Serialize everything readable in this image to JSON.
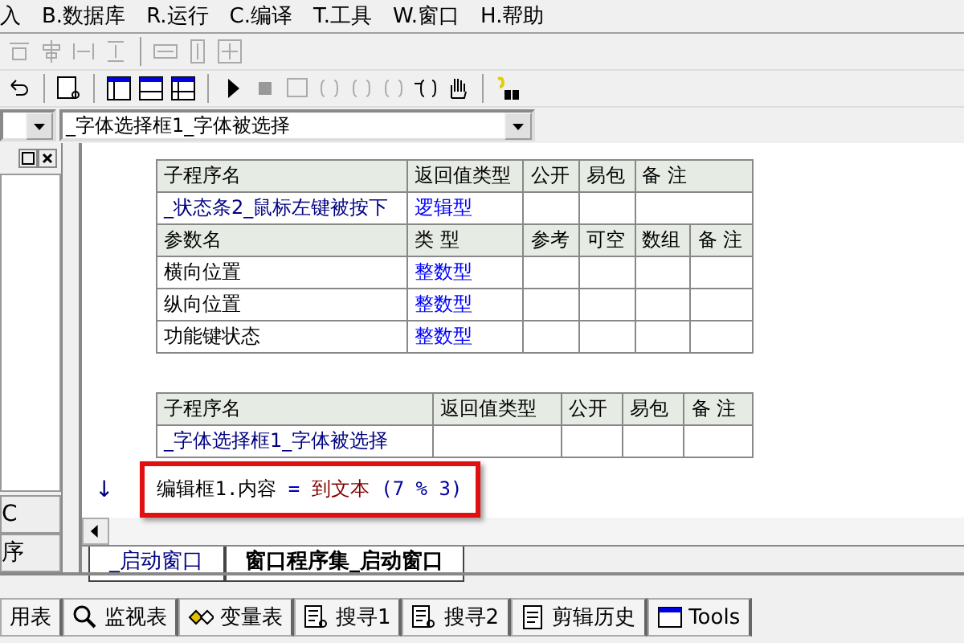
{
  "menu": [
    "入",
    "B.数据库",
    "R.运行",
    "C.编译",
    "T.工具",
    "W.窗口",
    "H.帮助"
  ],
  "combo": {
    "value": "_字体选择框1_字体被选择"
  },
  "left_panel": {
    "labels": [
      "C",
      "序"
    ]
  },
  "tables": [
    {
      "header": [
        "子程序名",
        "返回值类型",
        "公开",
        "易包",
        "备 注"
      ],
      "name": "_状态条2_鼠标左键被按下",
      "return_type": "逻辑型",
      "param_header": [
        "参数名",
        "类 型",
        "参考",
        "可空",
        "数组",
        "备 注"
      ],
      "params": [
        {
          "name": "横向位置",
          "type": "整数型"
        },
        {
          "name": "纵向位置",
          "type": "整数型"
        },
        {
          "name": "功能键状态",
          "type": "整数型"
        }
      ]
    },
    {
      "header": [
        "子程序名",
        "返回值类型",
        "公开",
        "易包",
        "备 注"
      ],
      "name": "_字体选择框1_字体被选择"
    }
  ],
  "code_line": {
    "arrow": "↓",
    "target": "编辑框1.内容",
    "operator": "=",
    "function": "到文本",
    "args": "(7 % 3)",
    "highlighted": true
  },
  "tabs": [
    {
      "label": "_启动窗口",
      "selected": false
    },
    {
      "label": "窗口程序集_启动窗口",
      "selected": true
    }
  ],
  "bottom_tabs": [
    {
      "label": "用表",
      "kind": "none"
    },
    {
      "label": "监视表",
      "kind": "search"
    },
    {
      "label": "变量表",
      "kind": "vars"
    },
    {
      "label": "搜寻1",
      "kind": "doc"
    },
    {
      "label": "搜寻2",
      "kind": "doc"
    },
    {
      "label": "剪辑历史",
      "kind": "note"
    },
    {
      "label": "Tools",
      "kind": "window"
    }
  ]
}
